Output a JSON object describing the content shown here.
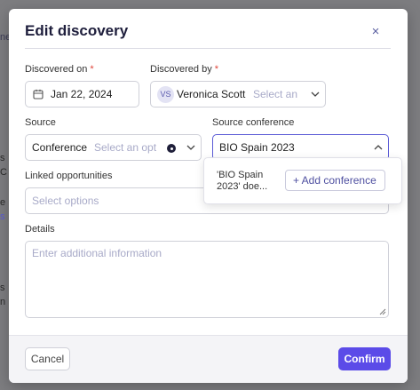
{
  "modal": {
    "title": "Edit discovery",
    "close_symbol": "×",
    "close_icon": "close-icon"
  },
  "fields": {
    "discovered_on": {
      "label": "Discovered on",
      "required_mark": "*",
      "value": "Jan 22, 2024",
      "icon": "calendar-icon"
    },
    "discovered_by": {
      "label": "Discovered by",
      "required_mark": "*",
      "avatar_initials": "VS",
      "value": "Veronica Scott",
      "placeholder": "Select an",
      "icon": "chevron-down-icon"
    },
    "source": {
      "label": "Source",
      "value": "Conference",
      "placeholder": "Select an opt",
      "icon": "chevron-down-icon"
    },
    "source_conference": {
      "label": "Source conference",
      "value": "BIO Spain 2023",
      "icon": "chevron-up-icon"
    },
    "linked_opportunities": {
      "label": "Linked opportunities",
      "placeholder": "Select options"
    },
    "details": {
      "label": "Details",
      "placeholder": "Enter additional information"
    }
  },
  "conference_dropdown": {
    "no_match_text": "'BIO Spain 2023' doe...",
    "add_button_label": "+ Add conference"
  },
  "footer": {
    "cancel_label": "Cancel",
    "confirm_label": "Confirm"
  },
  "colors": {
    "accent": "#5b4be8",
    "required": "#e0453a",
    "focus_border": "#5b5bd6"
  }
}
